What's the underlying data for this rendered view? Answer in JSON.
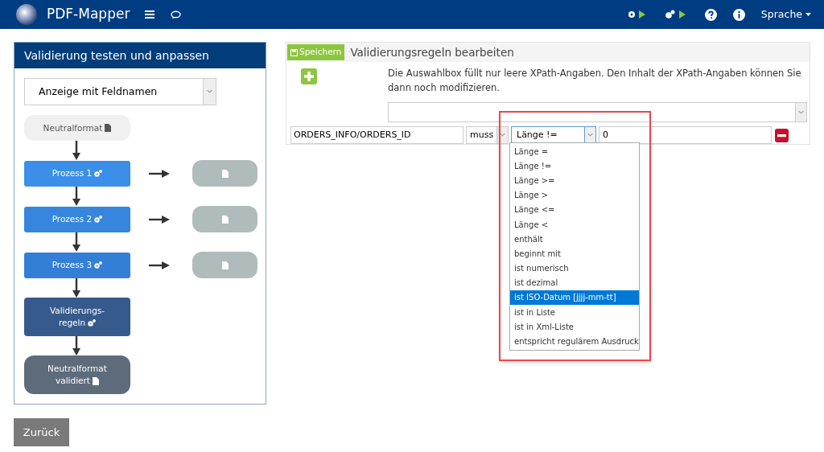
{
  "navbar": {
    "brand": "PDF-Mapper",
    "language_menu": "Sprache"
  },
  "left_panel": {
    "title": "Validierung testen und anpassen",
    "view_select": "Anzeige mit Feldnamen",
    "flow": [
      {
        "kind": "start",
        "label": "Neutralformat",
        "color": "#f0f0f0"
      },
      {
        "kind": "process",
        "label": "Prozess 1",
        "color": "#3b8fe8"
      },
      {
        "kind": "process",
        "label": "Prozess 2",
        "color": "#3686de"
      },
      {
        "kind": "process",
        "label": "Prozess 3",
        "color": "#337fd8"
      },
      {
        "kind": "rules",
        "label": "Validierungs-\nregeln",
        "color": "#375a8c"
      },
      {
        "kind": "end",
        "label": "Neutralformat\nvalidiert",
        "color": "#5d6b7a"
      }
    ]
  },
  "back_button": "Zurück",
  "editor": {
    "save_button": "Speichern",
    "title": "Validierungsregeln bearbeiten",
    "hint": "Die Auswahlbox füllt nur leere XPath-Angaben. Den Inhalt der XPath-Angaben können Sie dann noch modifizieren.",
    "rule": {
      "xpath": "ORDERS_INFO/ORDERS_ID",
      "modality": "muss",
      "operator": "Länge !=",
      "value": "0"
    },
    "operator_options": [
      {
        "label": "Länge =",
        "selected": false
      },
      {
        "label": "Länge !=",
        "selected": false
      },
      {
        "label": "Länge >=",
        "selected": false
      },
      {
        "label": "Länge >",
        "selected": false
      },
      {
        "label": "Länge <=",
        "selected": false
      },
      {
        "label": "Länge <",
        "selected": false
      },
      {
        "label": "enthält",
        "selected": false
      },
      {
        "label": "beginnt mit",
        "selected": false
      },
      {
        "label": "ist numerisch",
        "selected": false
      },
      {
        "label": "ist dezimal",
        "selected": false
      },
      {
        "label": "ist ISO-Datum [jjjj-mm-tt]",
        "selected": true
      },
      {
        "label": "ist in Liste",
        "selected": false
      },
      {
        "label": "ist in Xml-Liste",
        "selected": false
      },
      {
        "label": "entspricht regulärem Ausdruck",
        "selected": false
      }
    ]
  }
}
